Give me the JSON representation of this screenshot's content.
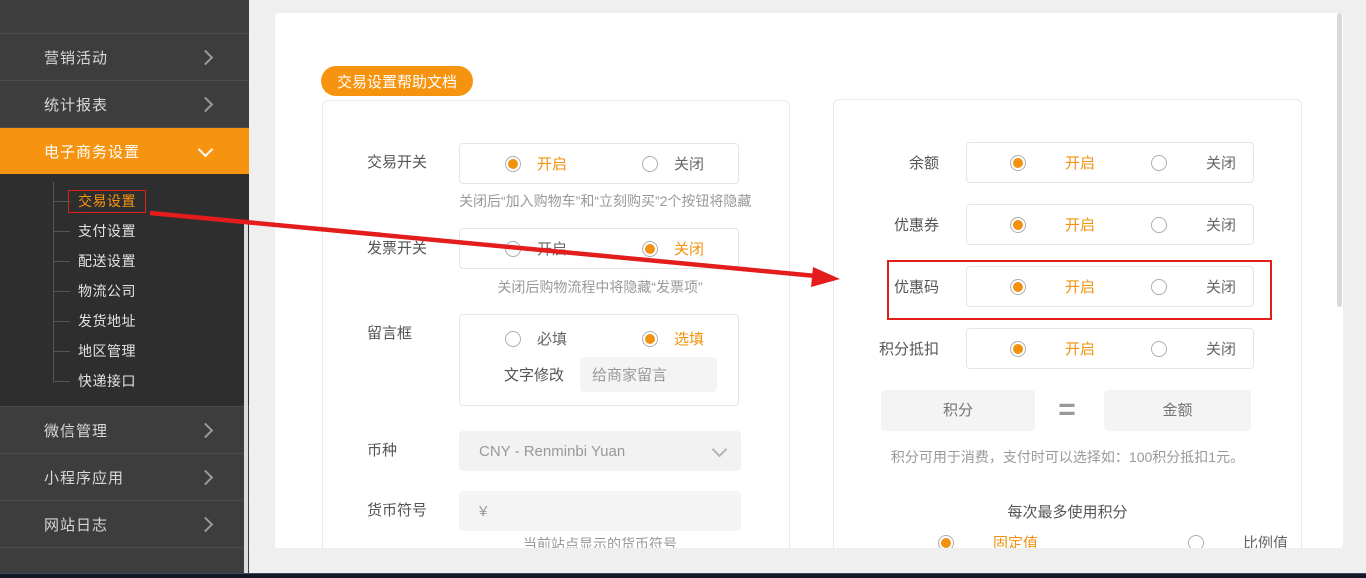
{
  "colors": {
    "accent": "#f7940f",
    "radio_orange": "#f0920e",
    "annotation_red": "#e02016",
    "sidebar_bg": "#3d3d3d",
    "submenu_bg": "#2e2e2e"
  },
  "sidebar": {
    "items": [
      {
        "label": "营销活动"
      },
      {
        "label": "统计报表"
      },
      {
        "label": "电子商务设置",
        "active": true
      },
      {
        "label": "微信管理"
      },
      {
        "label": "小程序应用"
      },
      {
        "label": "网站日志"
      }
    ],
    "submenu": [
      {
        "label": "交易设置",
        "active": true,
        "annotated": true
      },
      {
        "label": "支付设置"
      },
      {
        "label": "配送设置"
      },
      {
        "label": "物流公司"
      },
      {
        "label": "发货地址"
      },
      {
        "label": "地区管理"
      },
      {
        "label": "快递接口"
      }
    ]
  },
  "main": {
    "help_button": "交易设置帮助文档",
    "left": {
      "trade_switch": {
        "label": "交易开关",
        "on": "开启",
        "off": "关闭",
        "selected": "on",
        "hint": "关闭后“加入购物车”和“立刻购买”2个按钮将隐藏"
      },
      "invoice_switch": {
        "label": "发票开关",
        "on": "开启",
        "off": "关闭",
        "selected": "off",
        "hint": "关闭后购物流程中将隐藏“发票项”"
      },
      "message_box": {
        "label": "留言框",
        "required": "必填",
        "optional": "选填",
        "selected": "optional",
        "edit_label": "文字修改",
        "edit_value": "给商家留言"
      },
      "currency": {
        "label": "币种",
        "value": "CNY - Renminbi Yuan"
      },
      "currency_symbol": {
        "label": "货币符号",
        "value": "¥",
        "hint": "当前站点显示的货币符号"
      }
    },
    "right": {
      "rows": [
        {
          "label": "余额",
          "on": "开启",
          "off": "关闭",
          "selected": "on"
        },
        {
          "label": "优惠券",
          "on": "开启",
          "off": "关闭",
          "selected": "on"
        },
        {
          "label": "优惠码",
          "on": "开启",
          "off": "关闭",
          "selected": "on",
          "annotated": true
        },
        {
          "label": "积分抵扣",
          "on": "开启",
          "off": "关闭",
          "selected": "on"
        }
      ],
      "points_placeholder": "积分",
      "equals": "=",
      "amount_placeholder": "金额",
      "points_hint": "积分可用于消费，支付时可以选择如：100积分抵扣1元。",
      "max_points_title": "每次最多使用积分",
      "fixed": "固定值",
      "ratio": "比例值",
      "max_points_selected": "fixed"
    }
  }
}
